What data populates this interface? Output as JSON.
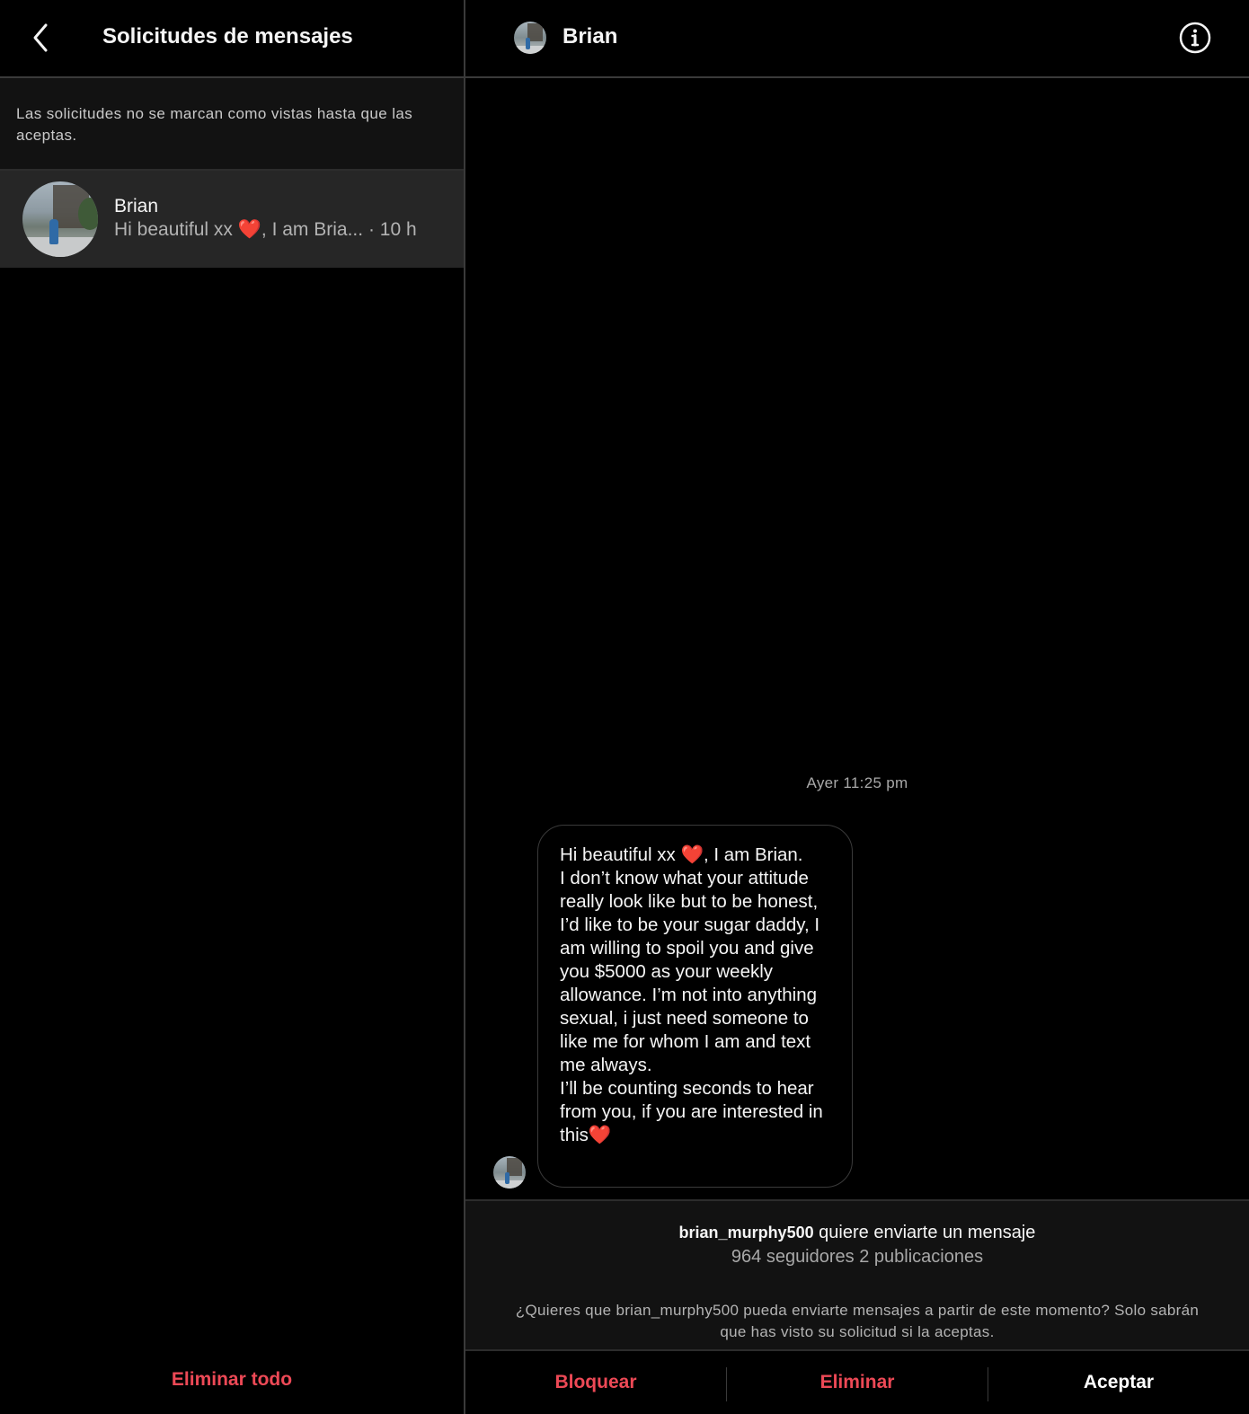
{
  "left": {
    "title": "Solicitudes de mensajes",
    "notice": "Las solicitudes no se marcan como vistas hasta que las aceptas.",
    "requests": [
      {
        "name": "Brian",
        "preview_text": "Hi beautiful xx",
        "preview_emoji": "❤️",
        "preview_rest": ", I am Bria...",
        "time": "· 10 h"
      }
    ],
    "delete_all_label": "Eliminar todo"
  },
  "chat": {
    "name": "Brian",
    "timestamp": "Ayer 11:25 pm",
    "message_part1": "Hi beautiful xx ",
    "message_heart1": "❤️",
    "message_part2": ", I am Brian.\nI don’t know what your attitude really look like but to be honest, I’d like to be your sugar daddy, I am willing to spoil you and give you $5000 as your weekly allowance. I’m not into anything sexual, i just need someone to like me for whom I am and text me always.\nI’ll be counting seconds to hear from you, if you are interested in this",
    "message_heart2": "❤️"
  },
  "request_info": {
    "username": "brian_murphy500",
    "wants_text": " quiere enviarte un mensaje",
    "stats": "964 seguidores 2 publicaciones",
    "question": "¿Quieres que brian_murphy500 pueda enviarte mensajes a partir de este momento? Solo sabrán que has visto su solicitud si la aceptas."
  },
  "actions": {
    "block_label": "Bloquear",
    "delete_label": "Eliminar",
    "accept_label": "Aceptar"
  },
  "icons": {
    "back": "chevron-left-icon",
    "info": "info-circle-icon"
  },
  "colors": {
    "danger": "#ed4956",
    "background": "#000000",
    "panel": "#121212",
    "selected": "#262626",
    "heart": "#e0262f"
  }
}
